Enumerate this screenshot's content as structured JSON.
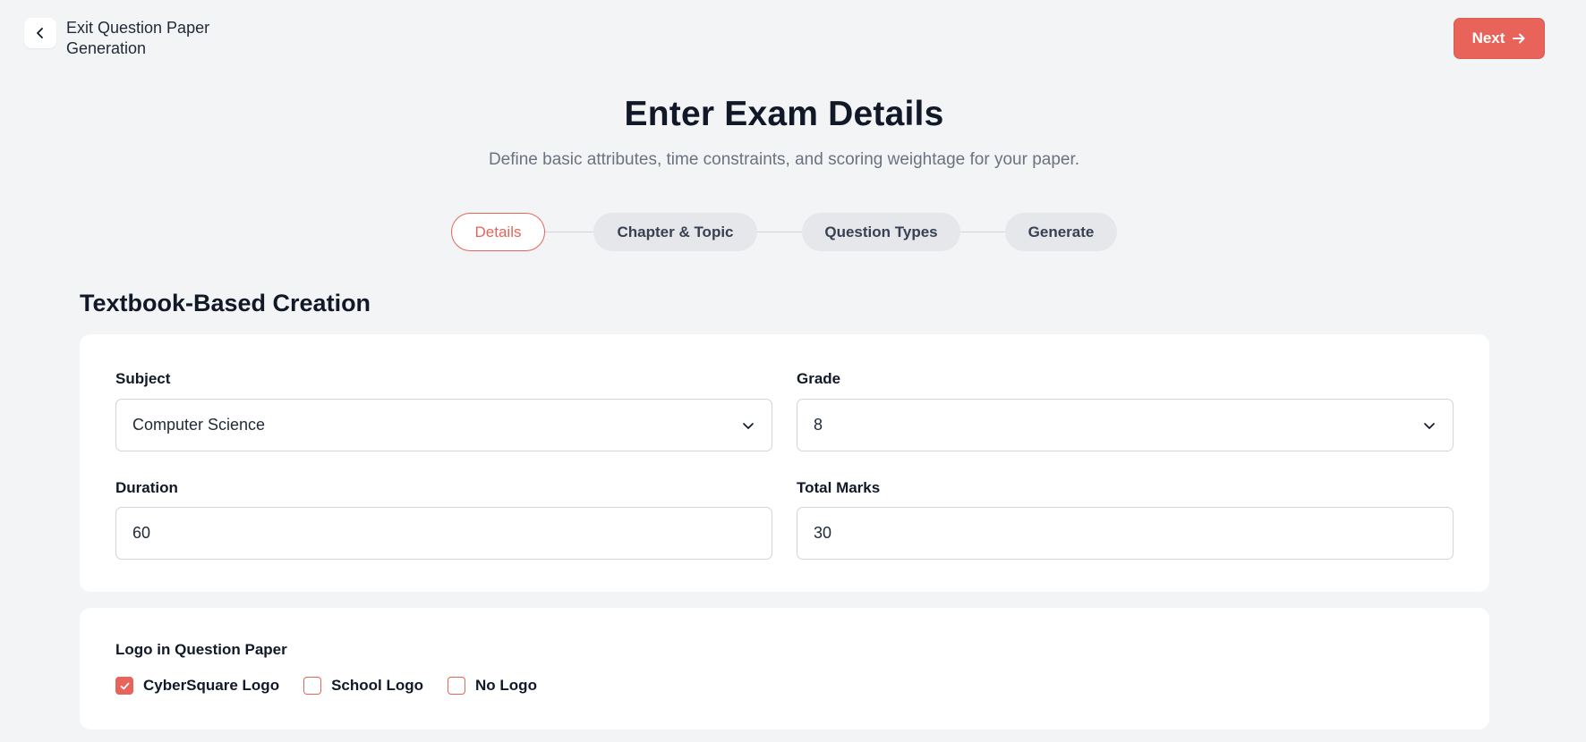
{
  "header": {
    "exit_label": "Exit Question Paper Generation",
    "next_label": "Next"
  },
  "main": {
    "title": "Enter Exam Details",
    "subtitle": "Define basic attributes, time constraints, and scoring weightage for your paper."
  },
  "stepper": {
    "steps": [
      {
        "label": "Details",
        "active": true
      },
      {
        "label": "Chapter & Topic",
        "active": false
      },
      {
        "label": "Question Types",
        "active": false
      },
      {
        "label": "Generate",
        "active": false
      }
    ]
  },
  "section": {
    "title": "Textbook-Based Creation"
  },
  "form": {
    "subject": {
      "label": "Subject",
      "value": "Computer Science"
    },
    "grade": {
      "label": "Grade",
      "value": "8"
    },
    "duration": {
      "label": "Duration",
      "value": "60"
    },
    "total_marks": {
      "label": "Total Marks",
      "value": "30"
    }
  },
  "logo": {
    "label": "Logo in Question Paper",
    "options": [
      {
        "label": "CyberSquare Logo",
        "checked": true
      },
      {
        "label": "School Logo",
        "checked": false
      },
      {
        "label": "No Logo",
        "checked": false
      }
    ]
  },
  "colors": {
    "accent": "#e8635a",
    "background": "#f3f4f6",
    "card": "#ffffff"
  },
  "icons": {
    "back": "chevron-left-icon",
    "next": "arrow-right-icon",
    "dropdown": "chevron-down-icon",
    "check": "check-icon"
  }
}
